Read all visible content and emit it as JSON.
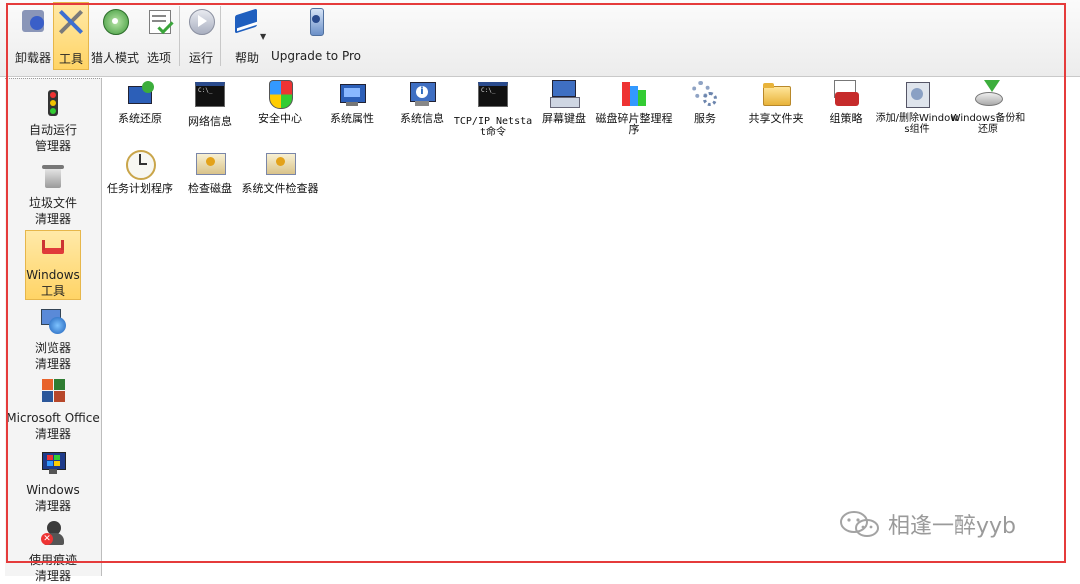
{
  "toolbar": {
    "items": [
      {
        "label": "卸载器",
        "icon": "uninstaller-icon"
      },
      {
        "label": "工具",
        "icon": "tools-icon",
        "active": true
      },
      {
        "label": "猎人模式",
        "icon": "hunter-mode-icon"
      },
      {
        "label": "选项",
        "icon": "options-icon"
      },
      {
        "label": "运行",
        "icon": "run-icon"
      },
      {
        "label": "帮助",
        "icon": "help-book-icon"
      },
      {
        "label": "Upgrade to Pro",
        "icon": "upgrade-icon"
      }
    ]
  },
  "sidebar": {
    "items": [
      {
        "label1": "自动运行",
        "label2": "管理器",
        "icon": "traffic-light-icon"
      },
      {
        "label1": "垃圾文件",
        "label2": "清理器",
        "icon": "junk-files-icon"
      },
      {
        "label1": "Windows",
        "label2": "工具",
        "icon": "windows-tools-icon",
        "active": true
      },
      {
        "label1": "浏览器",
        "label2": "清理器",
        "icon": "browser-cleaner-icon"
      },
      {
        "label1": "Microsoft Office",
        "label2": "清理器",
        "icon": "office-cleaner-icon"
      },
      {
        "label1": "Windows",
        "label2": "清理器",
        "icon": "windows-cleaner-icon"
      },
      {
        "label1": "使用痕迹",
        "label2": "清理器",
        "icon": "tracks-cleaner-icon"
      }
    ]
  },
  "tools": [
    {
      "label": "系统还原",
      "icon": "system-restore-icon"
    },
    {
      "label": "网络信息",
      "icon": "network-info-icon"
    },
    {
      "label": "安全中心",
      "icon": "security-center-icon"
    },
    {
      "label": "系统属性",
      "icon": "system-properties-icon"
    },
    {
      "label": "系统信息",
      "icon": "system-info-icon"
    },
    {
      "label": "TCP/IP Netstat命令",
      "icon": "netstat-icon"
    },
    {
      "label": "屏幕键盘",
      "icon": "screen-keyboard-icon"
    },
    {
      "label": "磁盘碎片整理程序",
      "icon": "defrag-icon"
    },
    {
      "label": "服务",
      "icon": "services-gear-icon"
    },
    {
      "label": "共享文件夹",
      "icon": "shared-folder-icon"
    },
    {
      "label": "组策略",
      "icon": "group-policy-icon"
    },
    {
      "label": "添加/删除Windows组件",
      "icon": "windows-components-icon"
    },
    {
      "label": "Windows备份和还原",
      "icon": "backup-restore-icon"
    },
    {
      "label": "任务计划程序",
      "icon": "task-scheduler-icon"
    },
    {
      "label": "检查磁盘",
      "icon": "check-disk-icon"
    },
    {
      "label": "系统文件检查器",
      "icon": "sfc-icon"
    }
  ],
  "watermark": {
    "text": "相逢一醉yyb"
  },
  "colors": {
    "highlight": "#ffd466",
    "frame": "#e53b3b"
  }
}
